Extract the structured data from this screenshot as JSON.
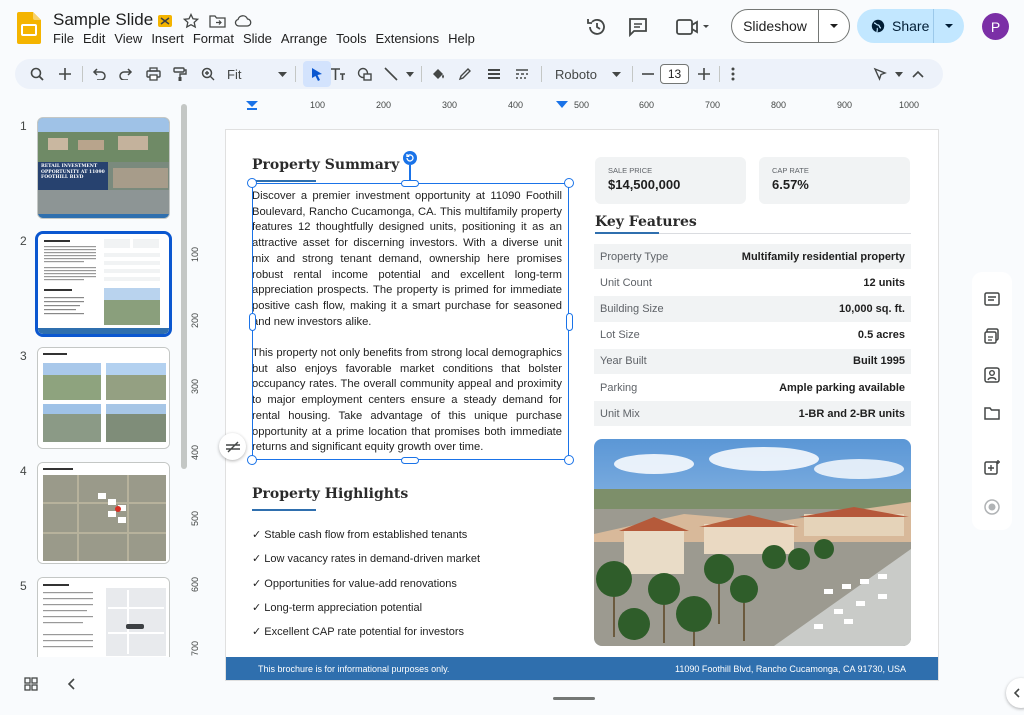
{
  "app": {
    "doc_title": "Sample Slide",
    "menus": [
      "File",
      "Edit",
      "View",
      "Insert",
      "Format",
      "Slide",
      "Arrange",
      "Tools",
      "Extensions",
      "Help"
    ],
    "slideshow_label": "Slideshow",
    "share_label": "Share",
    "avatar_initial": "P"
  },
  "toolbar": {
    "zoom": "Fit",
    "font": "Roboto",
    "font_size": "13"
  },
  "ruler": {
    "h_ticks": [
      "100",
      "200",
      "300",
      "400",
      "500",
      "600",
      "700",
      "800",
      "900",
      "1000"
    ],
    "v_ticks": [
      "100",
      "200",
      "300",
      "400",
      "500",
      "600",
      "700"
    ]
  },
  "filmstrip": {
    "slides": [
      {
        "num": "1"
      },
      {
        "num": "2"
      },
      {
        "num": "3"
      },
      {
        "num": "4"
      },
      {
        "num": "5"
      }
    ],
    "selected": "2",
    "slide1_caption": "RETAIL INVESTMENT OPPORTUNITY AT 11090 FOOTHILL BLVD"
  },
  "slide": {
    "summary_title": "Property Summary",
    "summary_p1": "Discover a premier investment opportunity at 11090 Foothill Boulevard, Rancho Cucamonga, CA. This multifamily property features 12 thoughtfully designed units, positioning it as an attractive asset for discerning investors. With a diverse unit mix and strong tenant demand, ownership here promises robust rental income potential and excellent long-term appreciation prospects. The property is primed for immediate positive cash flow, making it a smart purchase for seasoned and new investors alike.",
    "summary_p2": "This property not only benefits from strong local demographics but also enjoys favorable market conditions that bolster occupancy rates. The overall community appeal and proximity to major employment centers ensure a steady demand for rental housing. Take advantage of this unique purchase opportunity at a prime location that promises both immediate returns and significant equity growth over time.",
    "sale_price_label": "SALE PRICE",
    "sale_price": "$14,500,000",
    "cap_rate_label": "CAP RATE",
    "cap_rate": "6.57%",
    "key_features_title": "Key Features",
    "key_features": [
      {
        "k": "Property Type",
        "v": "Multifamily residential property"
      },
      {
        "k": "Unit Count",
        "v": "12 units"
      },
      {
        "k": "Building Size",
        "v": "10,000 sq. ft."
      },
      {
        "k": "Lot Size",
        "v": "0.5 acres"
      },
      {
        "k": "Year Built",
        "v": "Built 1995"
      },
      {
        "k": "Parking",
        "v": "Ample parking available"
      },
      {
        "k": "Unit Mix",
        "v": "1-BR and 2-BR units"
      }
    ],
    "highlights_title": "Property Highlights",
    "highlights": [
      "✓ Stable cash flow from established tenants",
      "✓ Low vacancy rates in demand-driven market",
      "✓ Opportunities for value-add renovations",
      "✓ Long-term appreciation potential",
      "✓ Excellent CAP rate potential for investors"
    ],
    "footer_left": "This brochure is for informational purposes only.",
    "footer_right": "11090 Foothill Blvd, Rancho Cucamonga, CA 91730, USA"
  },
  "colors": {
    "accent": "#0b57d0",
    "brand_blue": "#2f6fae",
    "share_bg": "#c2e7ff",
    "avatar": "#7b2fa6"
  }
}
